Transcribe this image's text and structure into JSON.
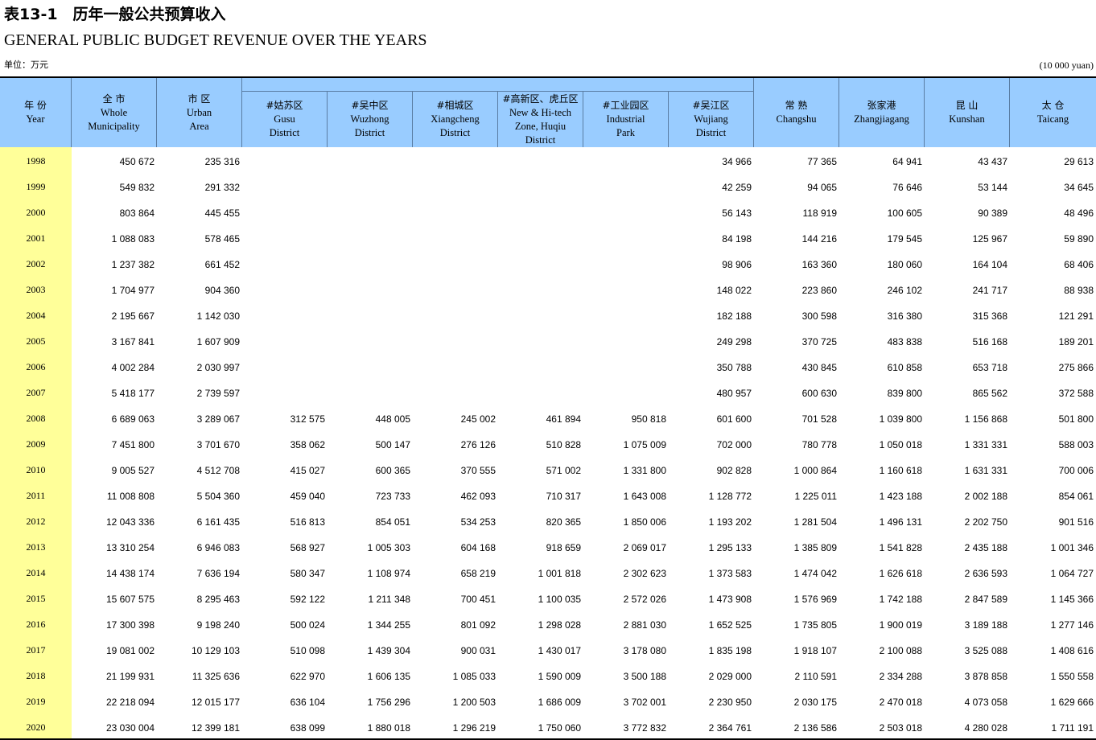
{
  "title_zh": "表13-1　历年一般公共预算收入",
  "title_en": "GENERAL PUBLIC BUDGET REVENUE OVER THE YEARS",
  "unit_zh": "单位：万元",
  "unit_en": "(10 000 yuan)",
  "columns": [
    {
      "zh": "年 份",
      "en": "Year"
    },
    {
      "zh": "全 市",
      "en": "Whole\nMunicipality"
    },
    {
      "zh": "市 区",
      "en": "Urban\nArea"
    },
    {
      "zh": "#姑苏区",
      "en": "Gusu\nDistrict"
    },
    {
      "zh": "#吴中区",
      "en": "Wuzhong\nDistrict"
    },
    {
      "zh": "#相城区",
      "en": "Xiangcheng\nDistrict"
    },
    {
      "zh": "#高新区、虎丘区",
      "en": "New & Hi-tech\nZone, Huqiu\nDistrict"
    },
    {
      "zh": "#工业园区",
      "en": "Industrial\nPark"
    },
    {
      "zh": "#吴江区",
      "en": "Wujiang\nDistrict"
    },
    {
      "zh": "常 熟",
      "en": "Changshu"
    },
    {
      "zh": "张家港",
      "en": "Zhangjiagang"
    },
    {
      "zh": "昆 山",
      "en": "Kunshan"
    },
    {
      "zh": "太 仓",
      "en": "Taicang"
    }
  ],
  "rows": [
    [
      "1998",
      "450 672",
      "235 316",
      "",
      "",
      "",
      "",
      "",
      "34 966",
      "77 365",
      "64 941",
      "43 437",
      "29 613"
    ],
    [
      "1999",
      "549 832",
      "291 332",
      "",
      "",
      "",
      "",
      "",
      "42 259",
      "94 065",
      "76 646",
      "53 144",
      "34 645"
    ],
    [
      "2000",
      "803 864",
      "445 455",
      "",
      "",
      "",
      "",
      "",
      "56 143",
      "118 919",
      "100 605",
      "90 389",
      "48 496"
    ],
    [
      "2001",
      "1 088 083",
      "578 465",
      "",
      "",
      "",
      "",
      "",
      "84 198",
      "144 216",
      "179 545",
      "125 967",
      "59 890"
    ],
    [
      "2002",
      "1 237 382",
      "661 452",
      "",
      "",
      "",
      "",
      "",
      "98 906",
      "163 360",
      "180 060",
      "164 104",
      "68 406"
    ],
    [
      "2003",
      "1 704 977",
      "904 360",
      "",
      "",
      "",
      "",
      "",
      "148 022",
      "223 860",
      "246 102",
      "241 717",
      "88 938"
    ],
    [
      "2004",
      "2 195 667",
      "1 142 030",
      "",
      "",
      "",
      "",
      "",
      "182 188",
      "300 598",
      "316 380",
      "315 368",
      "121 291"
    ],
    [
      "2005",
      "3 167 841",
      "1 607 909",
      "",
      "",
      "",
      "",
      "",
      "249 298",
      "370 725",
      "483 838",
      "516 168",
      "189 201"
    ],
    [
      "2006",
      "4 002 284",
      "2 030 997",
      "",
      "",
      "",
      "",
      "",
      "350 788",
      "430 845",
      "610 858",
      "653 718",
      "275 866"
    ],
    [
      "2007",
      "5 418 177",
      "2 739 597",
      "",
      "",
      "",
      "",
      "",
      "480 957",
      "600 630",
      "839 800",
      "865 562",
      "372 588"
    ],
    [
      "2008",
      "6 689 063",
      "3 289 067",
      "312 575",
      "448 005",
      "245 002",
      "461 894",
      "950 818",
      "601 600",
      "701 528",
      "1 039 800",
      "1 156 868",
      "501 800"
    ],
    [
      "2009",
      "7 451 800",
      "3 701 670",
      "358 062",
      "500 147",
      "276 126",
      "510 828",
      "1 075 009",
      "702 000",
      "780 778",
      "1 050 018",
      "1 331 331",
      "588 003"
    ],
    [
      "2010",
      "9 005 527",
      "4 512 708",
      "415 027",
      "600 365",
      "370 555",
      "571 002",
      "1 331 800",
      "902 828",
      "1 000 864",
      "1 160 618",
      "1 631 331",
      "700 006"
    ],
    [
      "2011",
      "11 008 808",
      "5 504 360",
      "459 040",
      "723 733",
      "462 093",
      "710 317",
      "1 643 008",
      "1 128 772",
      "1 225 011",
      "1 423 188",
      "2 002 188",
      "854 061"
    ],
    [
      "2012",
      "12 043 336",
      "6 161 435",
      "516 813",
      "854 051",
      "534 253",
      "820 365",
      "1 850 006",
      "1 193 202",
      "1 281 504",
      "1 496 131",
      "2 202 750",
      "901 516"
    ],
    [
      "2013",
      "13 310 254",
      "6 946 083",
      "568 927",
      "1 005 303",
      "604 168",
      "918 659",
      "2 069 017",
      "1 295 133",
      "1 385 809",
      "1 541 828",
      "2 435 188",
      "1 001 346"
    ],
    [
      "2014",
      "14 438 174",
      "7 636 194",
      "580 347",
      "1 108 974",
      "658 219",
      "1 001 818",
      "2 302 623",
      "1 373 583",
      "1 474 042",
      "1 626 618",
      "2 636 593",
      "1 064 727"
    ],
    [
      "2015",
      "15 607 575",
      "8 295 463",
      "592 122",
      "1 211 348",
      "700 451",
      "1 100 035",
      "2 572 026",
      "1 473 908",
      "1 576 969",
      "1 742 188",
      "2 847 589",
      "1 145 366"
    ],
    [
      "2016",
      "17 300 398",
      "9 198 240",
      "500 024",
      "1 344 255",
      "801 092",
      "1 298 028",
      "2 881 030",
      "1 652 525",
      "1 735 805",
      "1 900 019",
      "3 189 188",
      "1 277 146"
    ],
    [
      "2017",
      "19 081 002",
      "10 129 103",
      "510 098",
      "1 439 304",
      "900 031",
      "1 430 017",
      "3 178 080",
      "1 835 198",
      "1 918 107",
      "2 100 088",
      "3 525 088",
      "1 408 616"
    ],
    [
      "2018",
      "21 199 931",
      "11 325 636",
      "622 970",
      "1 606 135",
      "1 085 033",
      "1 590 009",
      "3 500 188",
      "2 029 000",
      "2 110 591",
      "2 334 288",
      "3 878 858",
      "1 550 558"
    ],
    [
      "2019",
      "22 218 094",
      "12 015 177",
      "636 104",
      "1 756 296",
      "1 200 503",
      "1 686 009",
      "3 702 001",
      "2 230 950",
      "2 030 175",
      "2 470 018",
      "4 073 058",
      "1 629 666"
    ],
    [
      "2020",
      "23 030 004",
      "12 399 181",
      "638 099",
      "1 880 018",
      "1 296 219",
      "1 750 060",
      "3 772 832",
      "2 364 761",
      "2 136 586",
      "2 503 018",
      "4 280 028",
      "1 711 191"
    ]
  ]
}
